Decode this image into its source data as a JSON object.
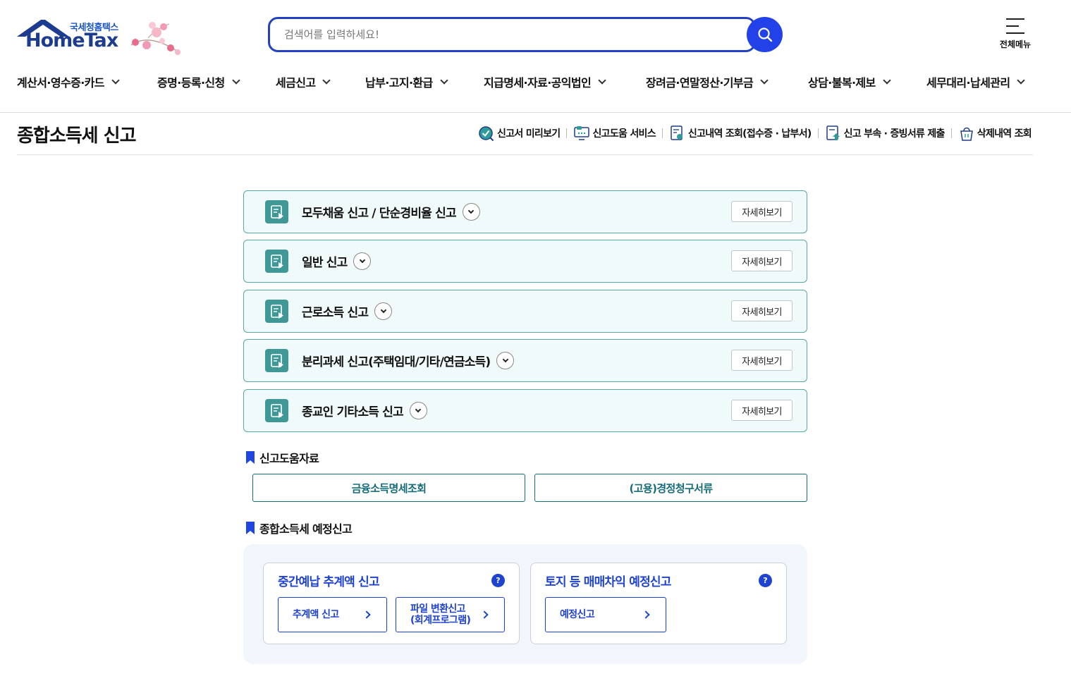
{
  "logo": {
    "sub": "국세청홈택스",
    "main": "HomeTax"
  },
  "search": {
    "placeholder": "검색어를 입력하세요!"
  },
  "all_menu": {
    "label": "전체메뉴"
  },
  "gnb": [
    {
      "label": "계산서·영수증·카드"
    },
    {
      "label": "증명·등록·신청"
    },
    {
      "label": "세금신고"
    },
    {
      "label": "납부·고지·환급"
    },
    {
      "label": "지급명세·자료·공익법인"
    },
    {
      "label": "장려금·연말정산·기부금"
    },
    {
      "label": "상담·불복·제보"
    },
    {
      "label": "세무대리·납세관리"
    }
  ],
  "page": {
    "title": "종합소득세 신고"
  },
  "quick_links": [
    {
      "label": "신고서 미리보기",
      "icon": "magnifier-check-icon"
    },
    {
      "label": "신고도움 서비스",
      "icon": "monitor-chat-icon"
    },
    {
      "label": "신고내역 조회(접수증 · 납부서)",
      "icon": "document-search-icon"
    },
    {
      "label": "신고 부속 · 증빙서류 제출",
      "icon": "document-upload-icon"
    },
    {
      "label": "삭제내역 조회",
      "icon": "trash-basket-icon"
    }
  ],
  "accordions": [
    {
      "title": "모두채움 신고 / 단순경비율 신고",
      "more": "자세히보기"
    },
    {
      "title": "일반 신고",
      "more": "자세히보기"
    },
    {
      "title": "근로소득 신고",
      "more": "자세히보기"
    },
    {
      "title": "분리과세 신고(주택임대/기타/연금소득)",
      "more": "자세히보기"
    },
    {
      "title": "종교인 기타소득 신고",
      "more": "자세히보기"
    }
  ],
  "help_section": {
    "title": "신고도움자료",
    "links": [
      "금융소득명세조회",
      "(고용)경정청구서류"
    ]
  },
  "pre_section": {
    "title": "종합소득세 예정신고",
    "cards": [
      {
        "title": "중간예납 추계액 신고",
        "help": "?",
        "buttons": [
          {
            "line1": "추계액 신고",
            "line2": ""
          },
          {
            "line1": "파일 변환신고",
            "line2": "(회계프로그램)"
          }
        ]
      },
      {
        "title": "토지 등 매매차익 예정신고",
        "help": "?",
        "buttons": [
          {
            "line1": "예정신고",
            "line2": ""
          }
        ]
      }
    ]
  },
  "colors": {
    "brand_blue": "#2341c5",
    "accordion_bg": "#f0fafa",
    "accordion_border": "#58a9a5",
    "teal_text": "#156c78",
    "link_blue": "#1e43d2"
  }
}
